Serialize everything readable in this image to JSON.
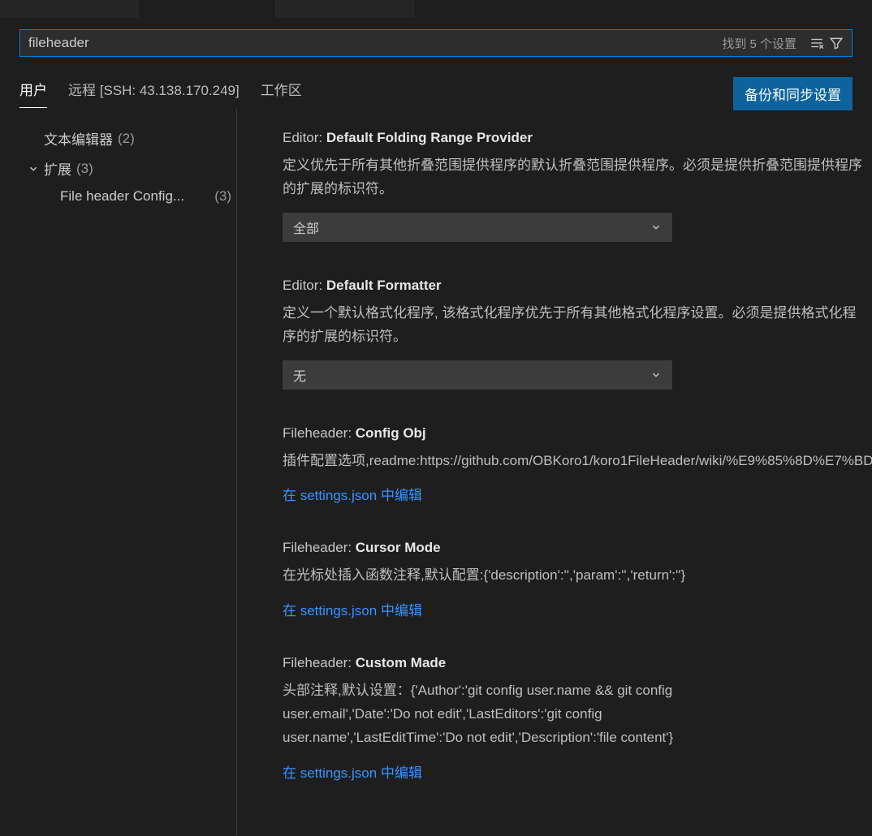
{
  "search": {
    "value": "fileheader",
    "result_text": "找到 5 个设置"
  },
  "scopes": {
    "user": "用户",
    "remote": "远程 [SSH: 43.138.170.249]",
    "workspace": "工作区"
  },
  "sync_button": "备份和同步设置",
  "sidebar": {
    "text_editor": {
      "label": "文本编辑器",
      "count": "(2)"
    },
    "extensions": {
      "label": "扩展",
      "count": "(3)"
    },
    "file_header": {
      "label": "File header Config...",
      "count": "(3)"
    }
  },
  "settings": [
    {
      "prefix": "Editor: ",
      "name": "Default Folding Range Provider",
      "desc": "定义优先于所有其他折叠范围提供程序的默认折叠范围提供程序。必须是提供折叠范围提供程序的扩展的标识符。",
      "select": "全部"
    },
    {
      "prefix": "Editor: ",
      "name": "Default Formatter",
      "desc": "定义一个默认格式化程序, 该格式化程序优先于所有其他格式化程序设置。必须是提供格式化程序的扩展的标识符。",
      "select": "无"
    },
    {
      "prefix": "Fileheader: ",
      "name": "Config Obj",
      "desc": "插件配置选项,readme:https://github.com/OBKoro1/koro1FileHeader/wiki/%E9%85%8D%E7%BD",
      "link": "在 settings.json 中编辑"
    },
    {
      "prefix": "Fileheader: ",
      "name": "Cursor Mode",
      "desc": "在光标处插入函数注释,默认配置:{'description':'','param':'','return':''}",
      "link": "在 settings.json 中编辑"
    },
    {
      "prefix": "Fileheader: ",
      "name": "Custom Made",
      "desc": "头部注释,默认设置：{'Author':'git config user.name && git config user.email','Date':'Do not edit','LastEditors':'git config user.name','LastEditTime':'Do not edit','Description':'file content'}",
      "link": "在 settings.json 中编辑"
    }
  ]
}
